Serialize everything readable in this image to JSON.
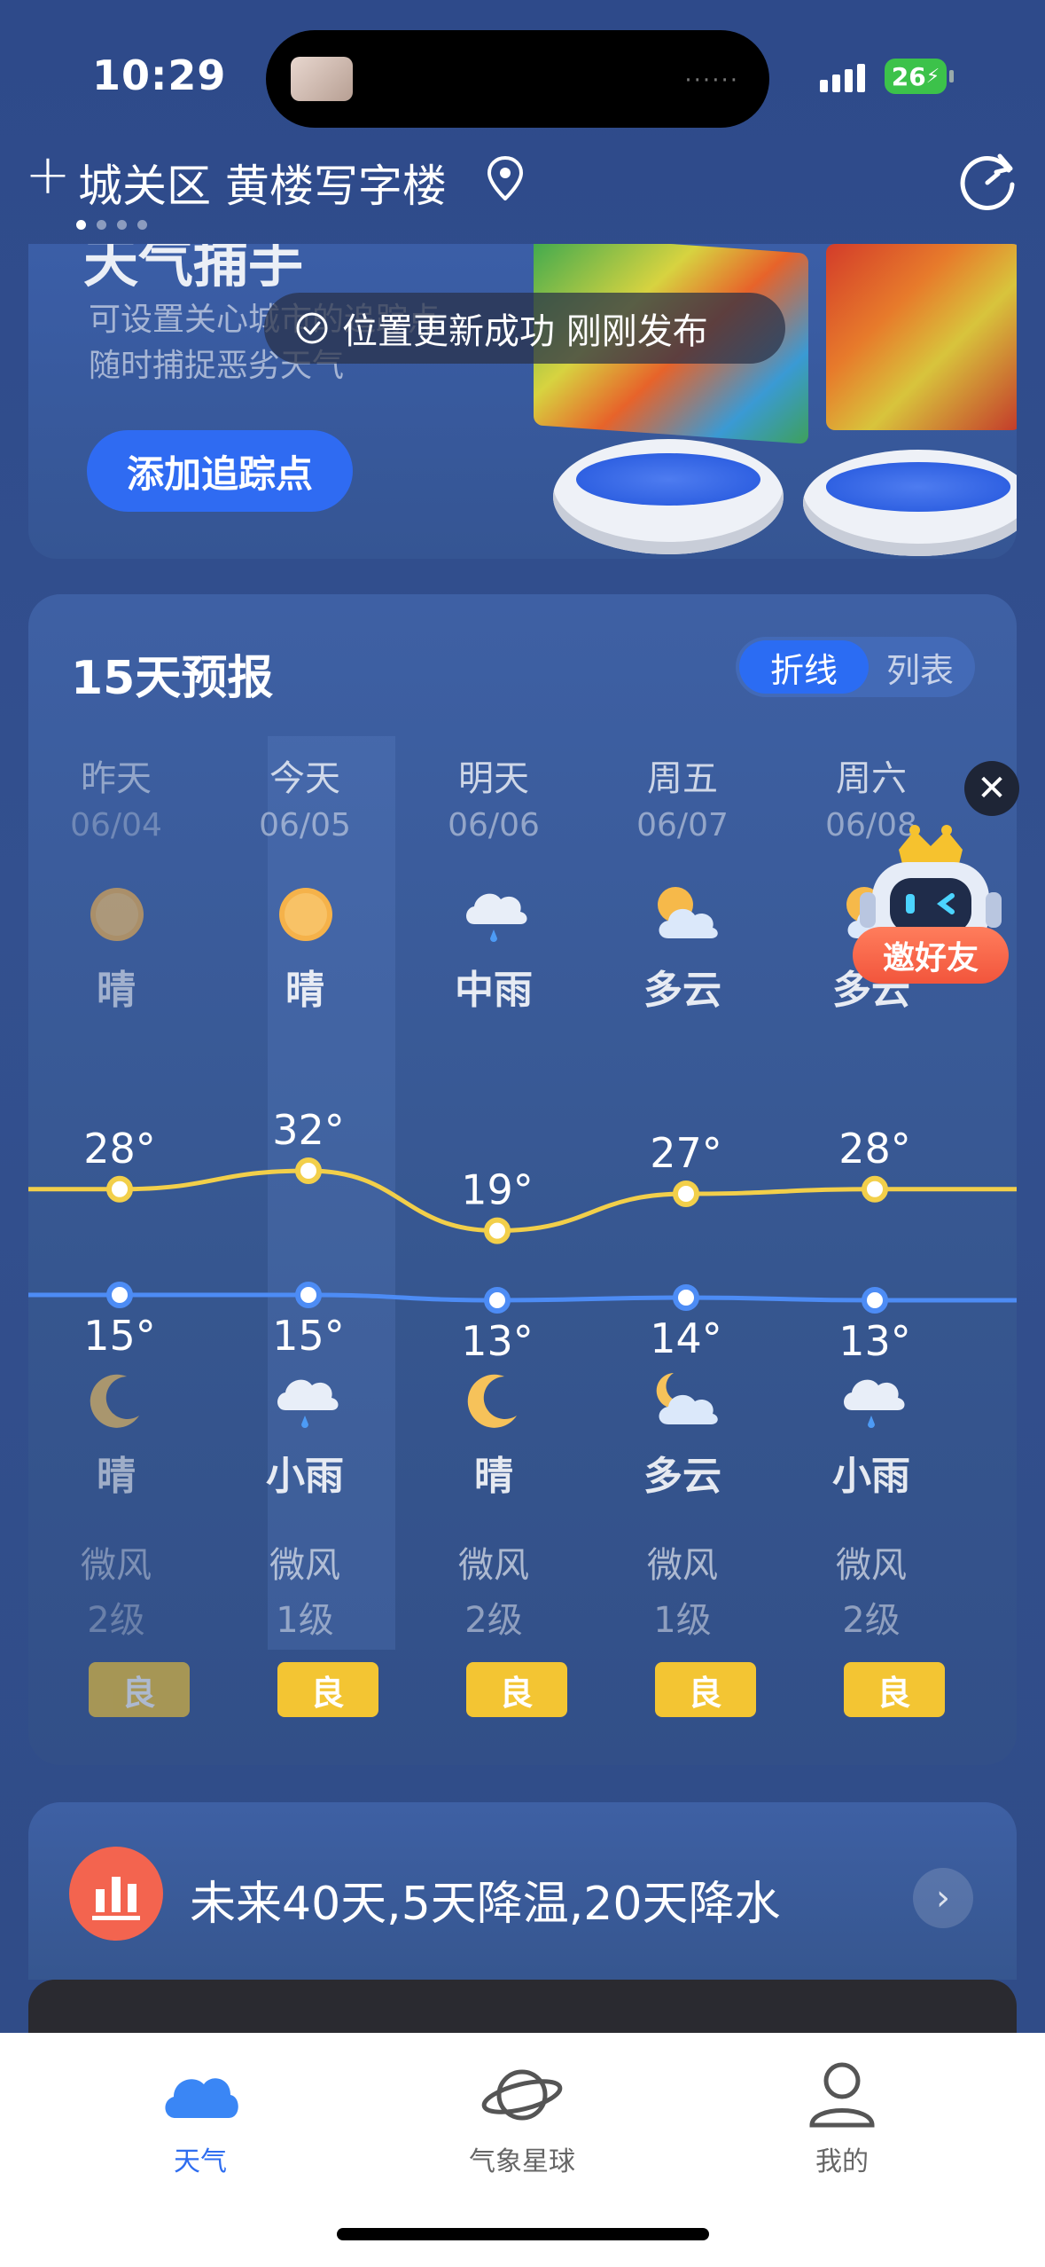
{
  "status_bar": {
    "time": "10:29",
    "battery": "26"
  },
  "header": {
    "location": "城关区 黄楼写字楼",
    "add_label": "+"
  },
  "tracker": {
    "title": "天气捕手",
    "desc_line1": "可设置关心城市的追踪点",
    "desc_line2": "随时捕捉恶劣天气",
    "button_label": "添加追踪点"
  },
  "toast": {
    "text": "位置更新成功 刚刚发布"
  },
  "forecast": {
    "title": "15天预报",
    "toggle_line": "折线",
    "toggle_list": "列表",
    "days": [
      {
        "name": "昨天",
        "date": "06/04",
        "day_cond": "晴",
        "day_icon": "sun-icon",
        "high": "28°",
        "low": "15°",
        "night_icon": "moon-icon",
        "night_cond": "晴",
        "wind": "微风",
        "wind_level": "2级",
        "aqi": "良"
      },
      {
        "name": "今天",
        "date": "06/05",
        "day_cond": "晴",
        "day_icon": "sun-icon",
        "high": "32°",
        "low": "15°",
        "night_icon": "rain-cloud-icon",
        "night_cond": "小雨",
        "wind": "微风",
        "wind_level": "1级",
        "aqi": "良"
      },
      {
        "name": "明天",
        "date": "06/06",
        "day_cond": "中雨",
        "day_icon": "rain-cloud-icon",
        "high": "19°",
        "low": "13°",
        "night_icon": "moon-icon",
        "night_cond": "晴",
        "wind": "微风",
        "wind_level": "2级",
        "aqi": "良"
      },
      {
        "name": "周五",
        "date": "06/07",
        "day_cond": "多云",
        "day_icon": "partly-cloudy-icon",
        "high": "27°",
        "low": "14°",
        "night_icon": "partly-cloudy-night-icon",
        "night_cond": "多云",
        "wind": "微风",
        "wind_level": "1级",
        "aqi": "良"
      },
      {
        "name": "周六",
        "date": "06/08",
        "day_cond": "多云",
        "day_icon": "partly-cloudy-icon",
        "high": "28°",
        "low": "13°",
        "night_icon": "rain-cloud-icon",
        "night_cond": "小雨",
        "wind": "微风",
        "wind_level": "2级",
        "aqi": "良"
      }
    ],
    "high_temps": [
      28,
      32,
      19,
      27,
      28
    ],
    "low_temps": [
      15,
      15,
      13,
      14,
      13
    ],
    "high_color": "#f2cf4a",
    "low_color": "#4d8cf5"
  },
  "invite": {
    "label": "邀好友"
  },
  "trend": {
    "text": "未来40天,5天降温,20天降水"
  },
  "nav": {
    "weather": "天气",
    "planet": "气象星球",
    "mine": "我的"
  }
}
